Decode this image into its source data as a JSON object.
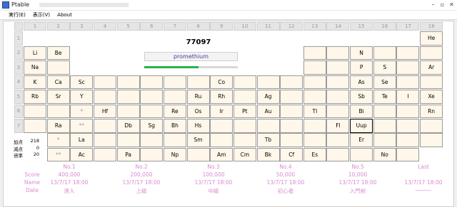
{
  "window": {
    "title": "Ptable",
    "min": "–",
    "max": "▫",
    "close": "✕",
    "icon": "ptable-app-icon"
  },
  "menu": [
    "実行(E)",
    "表示(V)",
    "About"
  ],
  "columns": [
    "1",
    "2",
    "3",
    "4",
    "5",
    "6",
    "7",
    "8",
    "9",
    "10",
    "11",
    "12",
    "13",
    "14",
    "15",
    "16",
    "17",
    "18"
  ],
  "rows": [
    "1",
    "2",
    "3",
    "4",
    "5",
    "6",
    "7"
  ],
  "quiz": {
    "number": "77097",
    "element_name": "promethium",
    "progress_fraction": 0.58
  },
  "colors": {
    "cell_bg": "#fff7ea",
    "score_text": "#d98bd0",
    "progress": "#26b14d",
    "name_text": "#4a3aa0"
  },
  "cells": [
    {
      "r": 1,
      "c": 18,
      "t": "He"
    },
    {
      "r": 2,
      "c": 1,
      "t": "Li"
    },
    {
      "r": 2,
      "c": 2,
      "t": "Be"
    },
    {
      "r": 2,
      "c": 13,
      "t": ""
    },
    {
      "r": 2,
      "c": 14,
      "t": ""
    },
    {
      "r": 2,
      "c": 15,
      "t": "N"
    },
    {
      "r": 2,
      "c": 16,
      "t": ""
    },
    {
      "r": 2,
      "c": 17,
      "t": ""
    },
    {
      "r": 2,
      "c": 18,
      "t": ""
    },
    {
      "r": 3,
      "c": 1,
      "t": "Na"
    },
    {
      "r": 3,
      "c": 2,
      "t": ""
    },
    {
      "r": 3,
      "c": 13,
      "t": ""
    },
    {
      "r": 3,
      "c": 14,
      "t": ""
    },
    {
      "r": 3,
      "c": 15,
      "t": "P"
    },
    {
      "r": 3,
      "c": 16,
      "t": "S"
    },
    {
      "r": 3,
      "c": 17,
      "t": ""
    },
    {
      "r": 3,
      "c": 18,
      "t": "Ar"
    },
    {
      "r": 4,
      "c": 1,
      "t": "K"
    },
    {
      "r": 4,
      "c": 2,
      "t": "Ca"
    },
    {
      "r": 4,
      "c": 3,
      "t": "Sc"
    },
    {
      "r": 4,
      "c": 4,
      "t": ""
    },
    {
      "r": 4,
      "c": 5,
      "t": ""
    },
    {
      "r": 4,
      "c": 6,
      "t": ""
    },
    {
      "r": 4,
      "c": 7,
      "t": ""
    },
    {
      "r": 4,
      "c": 8,
      "t": ""
    },
    {
      "r": 4,
      "c": 9,
      "t": "Co"
    },
    {
      "r": 4,
      "c": 10,
      "t": ""
    },
    {
      "r": 4,
      "c": 11,
      "t": ""
    },
    {
      "r": 4,
      "c": 12,
      "t": ""
    },
    {
      "r": 4,
      "c": 13,
      "t": ""
    },
    {
      "r": 4,
      "c": 14,
      "t": ""
    },
    {
      "r": 4,
      "c": 15,
      "t": "As"
    },
    {
      "r": 4,
      "c": 16,
      "t": "Se"
    },
    {
      "r": 4,
      "c": 17,
      "t": ""
    },
    {
      "r": 4,
      "c": 18,
      "t": ""
    },
    {
      "r": 5,
      "c": 1,
      "t": "Rb"
    },
    {
      "r": 5,
      "c": 2,
      "t": "Sr"
    },
    {
      "r": 5,
      "c": 3,
      "t": "Y"
    },
    {
      "r": 5,
      "c": 4,
      "t": ""
    },
    {
      "r": 5,
      "c": 5,
      "t": ""
    },
    {
      "r": 5,
      "c": 6,
      "t": ""
    },
    {
      "r": 5,
      "c": 7,
      "t": ""
    },
    {
      "r": 5,
      "c": 8,
      "t": "Ru"
    },
    {
      "r": 5,
      "c": 9,
      "t": "Rh"
    },
    {
      "r": 5,
      "c": 10,
      "t": ""
    },
    {
      "r": 5,
      "c": 11,
      "t": "Ag"
    },
    {
      "r": 5,
      "c": 12,
      "t": ""
    },
    {
      "r": 5,
      "c": 13,
      "t": ""
    },
    {
      "r": 5,
      "c": 14,
      "t": ""
    },
    {
      "r": 5,
      "c": 15,
      "t": "Sb"
    },
    {
      "r": 5,
      "c": 16,
      "t": "Te"
    },
    {
      "r": 5,
      "c": 17,
      "t": "I"
    },
    {
      "r": 5,
      "c": 18,
      "t": "Xe"
    },
    {
      "r": 6,
      "c": 1,
      "t": ""
    },
    {
      "r": 6,
      "c": 2,
      "t": ""
    },
    {
      "r": 6,
      "c": 3,
      "t": "*",
      "m": 1
    },
    {
      "r": 6,
      "c": 4,
      "t": "Hf"
    },
    {
      "r": 6,
      "c": 5,
      "t": ""
    },
    {
      "r": 6,
      "c": 6,
      "t": ""
    },
    {
      "r": 6,
      "c": 7,
      "t": "Re"
    },
    {
      "r": 6,
      "c": 8,
      "t": "Os"
    },
    {
      "r": 6,
      "c": 9,
      "t": "Ir"
    },
    {
      "r": 6,
      "c": 10,
      "t": "Pt"
    },
    {
      "r": 6,
      "c": 11,
      "t": "Au"
    },
    {
      "r": 6,
      "c": 12,
      "t": ""
    },
    {
      "r": 6,
      "c": 13,
      "t": "Tl"
    },
    {
      "r": 6,
      "c": 14,
      "t": ""
    },
    {
      "r": 6,
      "c": 15,
      "t": "Bi"
    },
    {
      "r": 6,
      "c": 16,
      "t": ""
    },
    {
      "r": 6,
      "c": 17,
      "t": ""
    },
    {
      "r": 6,
      "c": 18,
      "t": "Rn"
    },
    {
      "r": 7,
      "c": 1,
      "t": ""
    },
    {
      "r": 7,
      "c": 2,
      "t": "Ra"
    },
    {
      "r": 7,
      "c": 3,
      "t": "**",
      "m": 1
    },
    {
      "r": 7,
      "c": 4,
      "t": ""
    },
    {
      "r": 7,
      "c": 5,
      "t": "Db"
    },
    {
      "r": 7,
      "c": 6,
      "t": "Sg"
    },
    {
      "r": 7,
      "c": 7,
      "t": "Bh"
    },
    {
      "r": 7,
      "c": 8,
      "t": "Hs"
    },
    {
      "r": 7,
      "c": 9,
      "t": ""
    },
    {
      "r": 7,
      "c": 10,
      "t": ""
    },
    {
      "r": 7,
      "c": 11,
      "t": ""
    },
    {
      "r": 7,
      "c": 12,
      "t": ""
    },
    {
      "r": 7,
      "c": 13,
      "t": ""
    },
    {
      "r": 7,
      "c": 14,
      "t": "Fl"
    },
    {
      "r": 7,
      "c": 15,
      "t": "Uup",
      "s": 1
    },
    {
      "r": 7,
      "c": 16,
      "t": ""
    },
    {
      "r": 7,
      "c": 17,
      "t": ""
    },
    {
      "r": 7,
      "c": 18,
      "t": ""
    }
  ],
  "lanthanides": [
    "*",
    "La",
    "",
    "",
    "",
    "",
    "Sm",
    "",
    "",
    "Tb",
    "",
    "",
    "",
    "Er",
    "",
    "",
    ""
  ],
  "actinides": [
    "**",
    "Ac",
    "",
    "Pa",
    "",
    "Np",
    "",
    "Am",
    "Cm",
    "Bk",
    "Cf",
    "Es",
    "",
    "",
    "No",
    ""
  ],
  "stats": [
    {
      "label": "加点",
      "value": "218"
    },
    {
      "label": "減点",
      "value": "0"
    },
    {
      "label": "倍率",
      "value": "20"
    }
  ],
  "score_rows": [
    "Score",
    "Name",
    "Date"
  ],
  "score_cols": [
    {
      "head": "No.1",
      "score": "400,000",
      "name": "13/7/17 18:00",
      "date": "達人"
    },
    {
      "head": "No.2",
      "score": "200,000",
      "name": "13/7/17 18:00",
      "date": "上級"
    },
    {
      "head": "No.3",
      "score": "100,000",
      "name": "13/7/17 18:00",
      "date": "中級"
    },
    {
      "head": "No.4",
      "score": "50,000",
      "name": "13/7/17 18:00",
      "date": "初心者"
    },
    {
      "head": "No.5",
      "score": "10,000",
      "name": "13/7/17 18:00",
      "date": "入門前"
    },
    {
      "head": "Last",
      "score": "",
      "name": "13/7/17 18:00",
      "date": "―――"
    }
  ]
}
